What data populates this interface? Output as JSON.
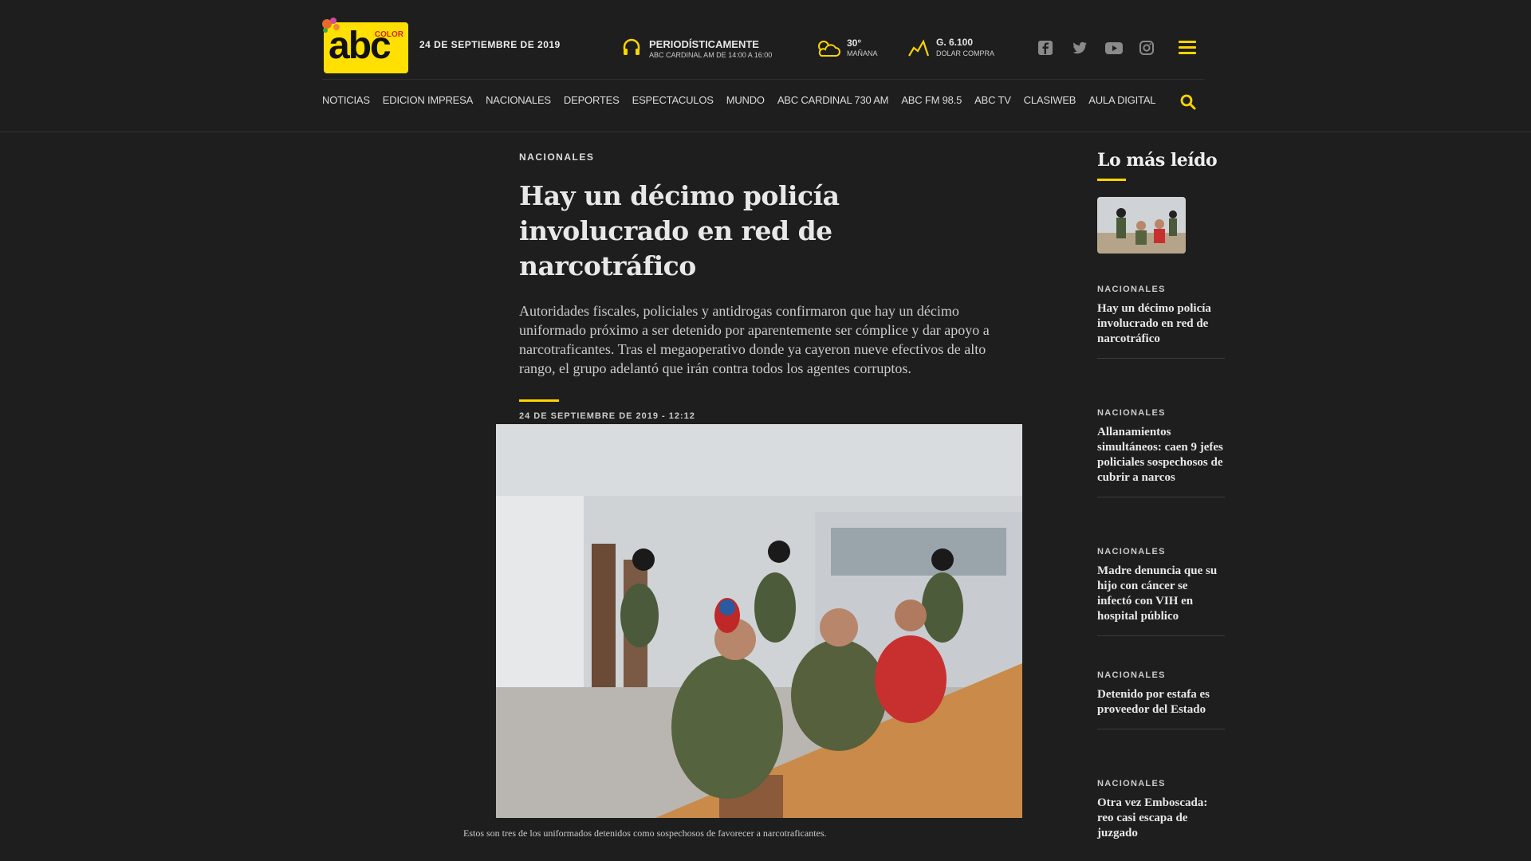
{
  "header": {
    "logo_text": "abc",
    "logo_sub": "COLOR",
    "date": "24 DE SEPTIEMBRE DE 2019",
    "radio_title": "PERIODÍSTICAMENTE",
    "radio_sub": "ABC CARDINAL AM DE 14:00 A 16:00",
    "weather_temp": "30°",
    "weather_label": "MAÑANA",
    "dollar_value": "G. 6.100",
    "dollar_label": "DOLAR COMPRA"
  },
  "icons": [
    "headphones-icon",
    "weather-icon",
    "dollar-chart-icon",
    "facebook-icon",
    "twitter-icon",
    "youtube-icon",
    "instagram-icon",
    "menu-icon",
    "search-icon"
  ],
  "nav": [
    "NOTICIAS",
    "EDICION IMPRESA",
    "NACIONALES",
    "DEPORTES",
    "ESPECTACULOS",
    "MUNDO",
    "ABC CARDINAL 730 AM",
    "ABC FM 98.5",
    "ABC TV",
    "CLASIWEB",
    "AULA DIGITAL"
  ],
  "article": {
    "kicker": "NACIONALES",
    "title": "Hay un décimo policía involucrado en red de narcotráfico",
    "lead": "Autoridades fiscales, policiales y antidrogas confirmaron que hay un décimo uniformado próximo a ser detenido por aparentemente ser cómplice y dar apoyo a narcotraficantes. Tras el megaoperativo donde ya cayeron nueve efectivos de alto rango, el grupo adelantó que irán contra todos los agentes corruptos.",
    "date": "24 DE SEPTIEMBRE DE 2019 - 12:12",
    "caption": "Estos son tres de los uniformados detenidos como sospechosos de favorecer a narcotraficantes."
  },
  "sidebar": {
    "title": "Lo más leído",
    "items": [
      {
        "category": "NACIONALES",
        "title": "Hay un décimo policía involucrado en red de narcotráfico"
      },
      {
        "category": "NACIONALES",
        "title": "Allanamientos simultáneos: caen 9 jefes policiales sospechosos de cubrir a narcos"
      },
      {
        "category": "NACIONALES",
        "title": "Madre denuncia que su hijo con cáncer se infectó con VIH en hospital público"
      },
      {
        "category": "NACIONALES",
        "title": "Detenido por estafa es proveedor del Estado"
      },
      {
        "category": "NACIONALES",
        "title": "Otra vez Emboscada: reo casi escapa de juzgado"
      }
    ]
  },
  "colors": {
    "accent": "#ffd400",
    "background": "#1e1e1e",
    "logo": "#ffe000"
  }
}
